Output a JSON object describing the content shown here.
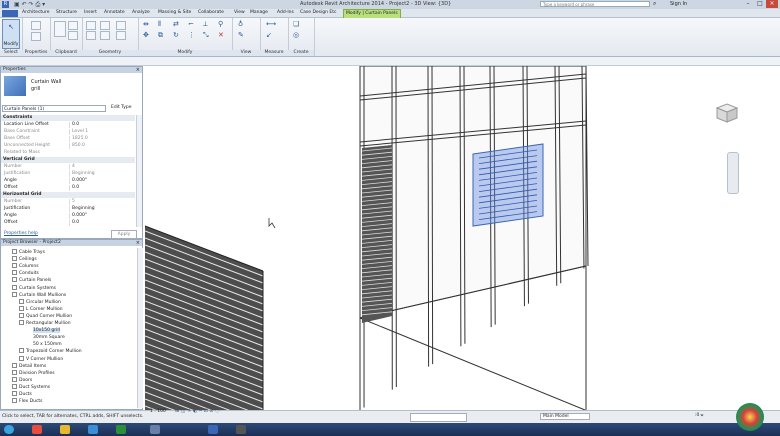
{
  "titlebar": {
    "title": "Autodesk Revit Architecture 2014 - Project2 - 3D View: {3D}",
    "search_placeholder": "Type a keyword or phrase",
    "sign_in": "Sign In"
  },
  "tabs": [
    "Architecture",
    "Structure",
    "Insert",
    "Annotate",
    "Analyze",
    "Massing & Site",
    "Collaborate",
    "View",
    "Manage",
    "Add-Ins",
    "Case Design Etc",
    "Modify | Curtain Panels"
  ],
  "ribbon": {
    "modify_label": "Modify",
    "select_label": "Select",
    "panels": [
      "Properties",
      "Clipboard",
      "Geometry",
      "Modify",
      "View",
      "Measure",
      "Create"
    ]
  },
  "properties": {
    "header": "Properties",
    "type_family": "Curtain Wall",
    "type_name": "grill",
    "selector": "Curtain Panels (1)",
    "edit_type": "Edit Type",
    "constraints_label": "Constraints",
    "constraints": [
      {
        "k": "Location Line Offset",
        "v": "0.0"
      },
      {
        "k": "Base Constraint",
        "v": "Level 1"
      },
      {
        "k": "Base Offset",
        "v": "1825.0"
      },
      {
        "k": "Unconnected Height",
        "v": "850.0"
      },
      {
        "k": "Related to Mass",
        "v": ""
      }
    ],
    "vertical_label": "Vertical Grid",
    "vertical": [
      {
        "k": "Number",
        "v": "4"
      },
      {
        "k": "Justification",
        "v": "Beginning"
      },
      {
        "k": "Angle",
        "v": "0.000°"
      },
      {
        "k": "Offset",
        "v": "0.0"
      }
    ],
    "horizontal_label": "Horizontal Grid",
    "horizontal": [
      {
        "k": "Number",
        "v": "5"
      },
      {
        "k": "Justification",
        "v": "Beginning"
      },
      {
        "k": "Angle",
        "v": "0.000°"
      },
      {
        "k": "Offset",
        "v": "0.0"
      }
    ],
    "help_link": "Properties help",
    "apply": "Apply"
  },
  "browser": {
    "header": "Project Browser - Project2",
    "items": [
      {
        "label": "Cable Trays",
        "level": 1
      },
      {
        "label": "Ceilings",
        "level": 1
      },
      {
        "label": "Columns",
        "level": 1
      },
      {
        "label": "Conduits",
        "level": 1
      },
      {
        "label": "Curtain Panels",
        "level": 1
      },
      {
        "label": "Curtain Systems",
        "level": 1
      },
      {
        "label": "Curtain Wall Mullions",
        "level": 1
      },
      {
        "label": "Circular Mullion",
        "level": 2
      },
      {
        "label": "L Corner Mullion",
        "level": 2
      },
      {
        "label": "Quad Corner Mullion",
        "level": 2
      },
      {
        "label": "Rectangular Mullion",
        "level": 2
      },
      {
        "label": "10x150 grill",
        "level": 3
      },
      {
        "label": "30mm Square",
        "level": 3
      },
      {
        "label": "50 x 150mm",
        "level": 3
      },
      {
        "label": "Trapezoid Corner Mullion",
        "level": 2
      },
      {
        "label": "V Corner Mullion",
        "level": 2
      },
      {
        "label": "Detail Items",
        "level": 1
      },
      {
        "label": "Division Profiles",
        "level": 1
      },
      {
        "label": "Doors",
        "level": 1
      },
      {
        "label": "Duct Systems",
        "level": 1
      },
      {
        "label": "Ducts",
        "level": 1
      },
      {
        "label": "Flex Ducts",
        "level": 1
      }
    ]
  },
  "view_control": {
    "scale": "1 : 100"
  },
  "statusbar": {
    "hint": "Click to select, TAB for alternates, CTRL adds, SHIFT unselects.",
    "model": "Main Model",
    "workset": ":0"
  },
  "colors": {
    "accent": "#3a66b8",
    "ribbon_green": "#b9e07c",
    "taskbar": "#1b2f55"
  }
}
